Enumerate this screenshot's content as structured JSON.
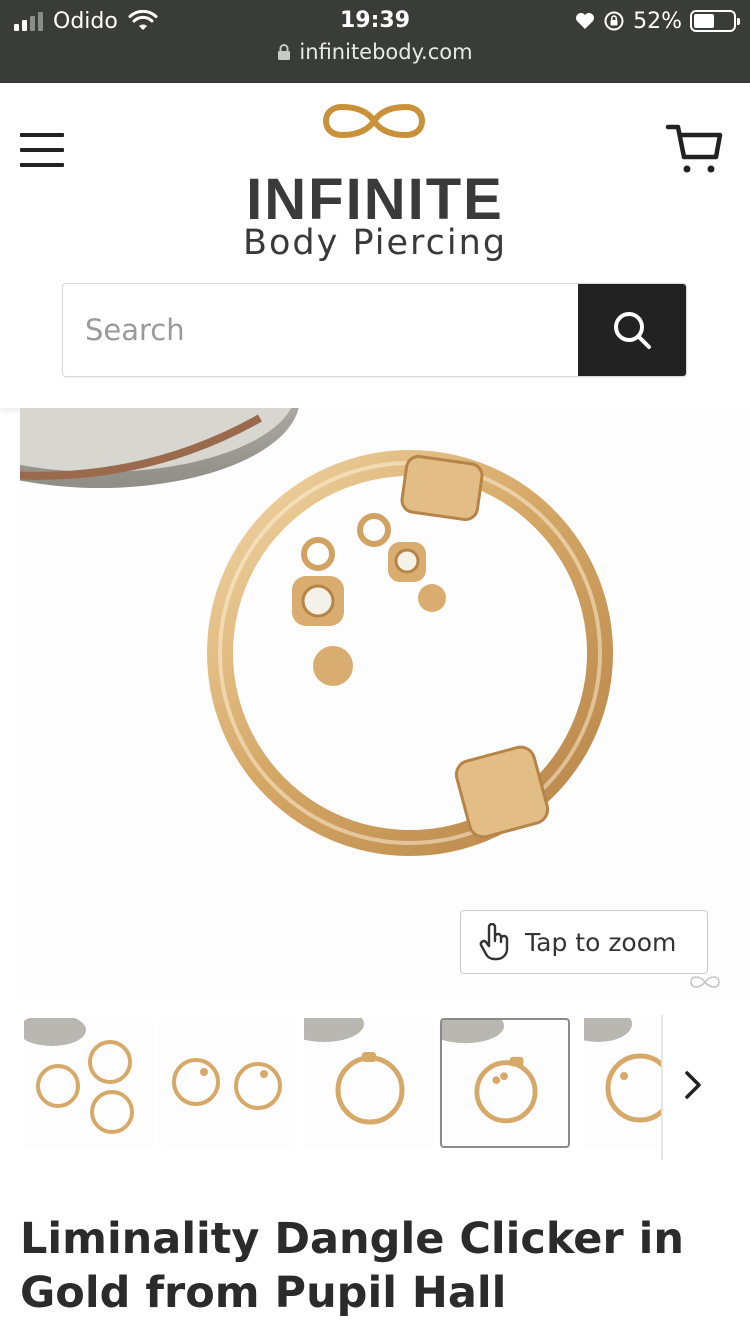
{
  "status_bar": {
    "carrier": "Odido",
    "time": "19:39",
    "battery": "52%",
    "battery_level": 0.52,
    "url": "infinitebody.com"
  },
  "header": {
    "brand": "INFINITE",
    "brand_sub": "Body Piercing",
    "brand_color": "#c8913a",
    "menu_icon": "hamburger-menu-icon",
    "cart_icon": "shopping-cart-icon"
  },
  "search": {
    "placeholder": "Search",
    "value": "",
    "button_icon": "search-icon"
  },
  "product": {
    "zoom_label": "Tap to zoom",
    "zoom_icon": "tap-hand-icon",
    "thumbnails": [
      {
        "selected": false
      },
      {
        "selected": false
      },
      {
        "selected": false
      },
      {
        "selected": true
      },
      {
        "selected": false
      }
    ],
    "next_icon": "chevron-right-icon",
    "title": "Liminality Dangle Clicker in Gold from Pupil Hall"
  }
}
